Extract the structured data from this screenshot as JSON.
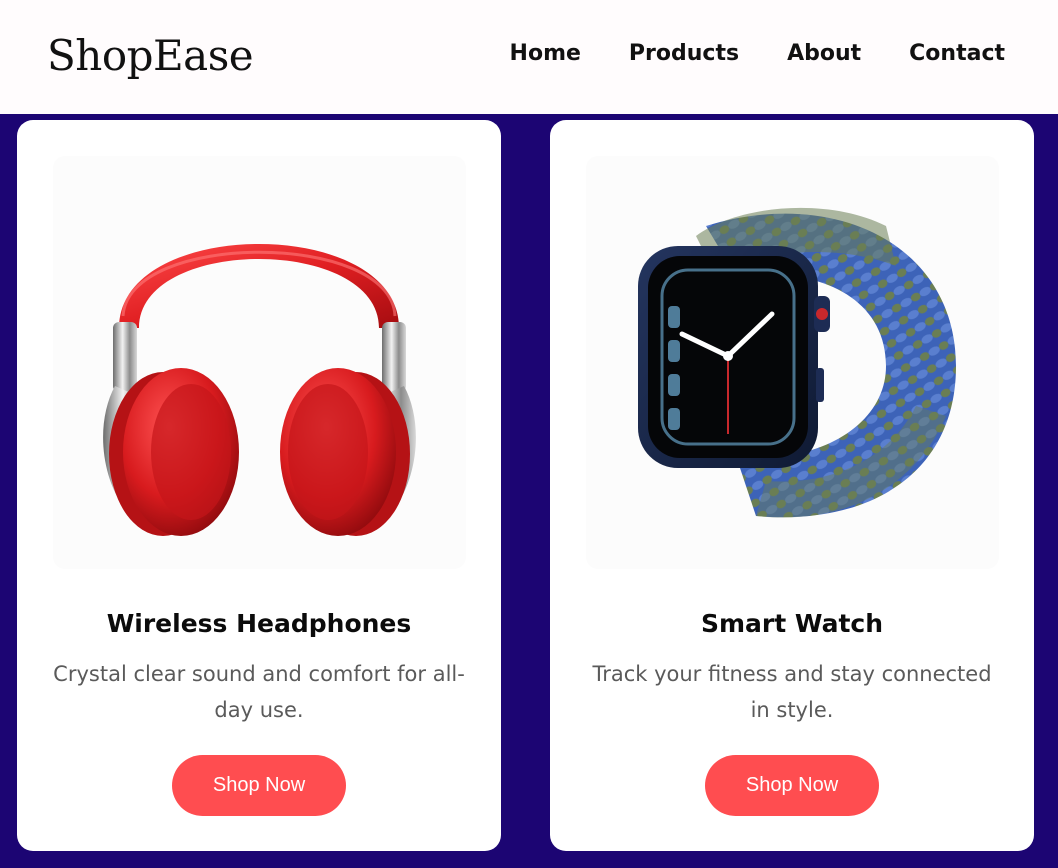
{
  "brand": "ShopEase",
  "nav": {
    "items": [
      "Home",
      "Products",
      "About",
      "Contact"
    ]
  },
  "colors": {
    "background": "#1c0573",
    "header": "#fffcfd",
    "button": "#ff4d50",
    "headphones": "#e3282a",
    "watch_band_blue": "#3d63b8",
    "watch_band_green": "#6a7e54"
  },
  "products": [
    {
      "name": "Wireless Headphones",
      "description": "Crystal clear sound and comfort for all-day use.",
      "button": "Shop Now",
      "image_icon": "headphones-icon"
    },
    {
      "name": "Smart Watch",
      "description": "Track your fitness and stay connected in style.",
      "button": "Shop Now",
      "image_icon": "smartwatch-icon"
    }
  ]
}
